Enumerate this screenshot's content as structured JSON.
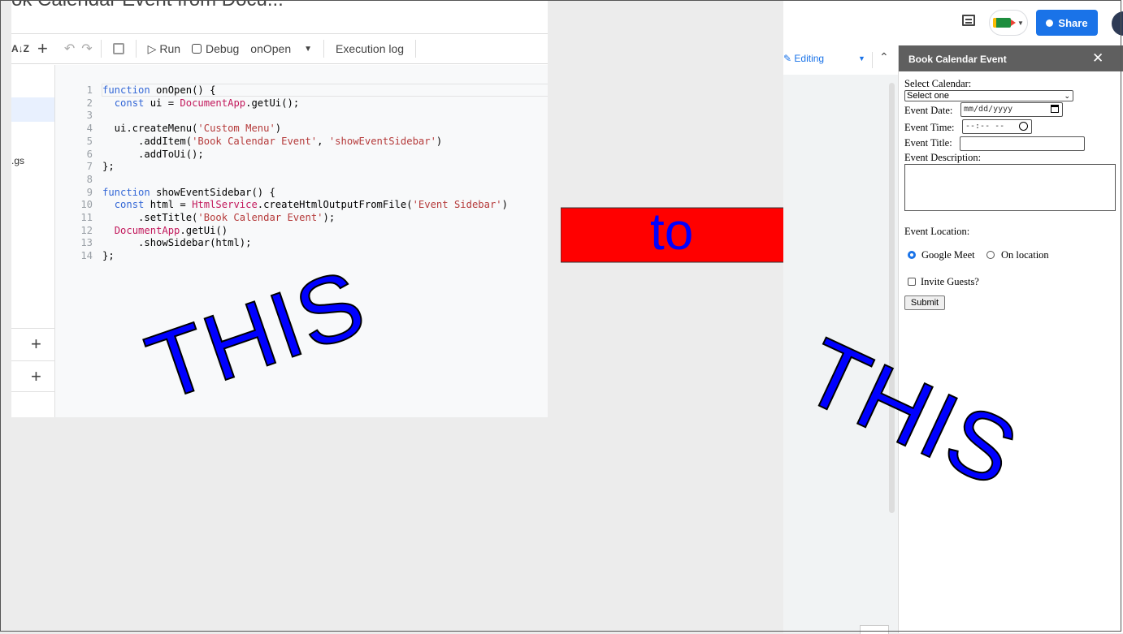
{
  "editor": {
    "title": "ok Calendar Event from Docu...",
    "toolbar": {
      "sort_icon": "A↓Z",
      "add_icon": "+",
      "undo_icon": "↶",
      "redo_icon": "↷",
      "save_icon": "💾",
      "run_label": "▷ Run",
      "debug_label": "Debug",
      "function_select": "onOpen",
      "function_caret": "▼",
      "execution_log_label": "Execution log"
    },
    "sidebar": {
      "file_label": ".gs",
      "add_library": "+",
      "add_service": "+"
    },
    "code": [
      {
        "n": "1",
        "html": "<span class='kw'>function</span> onOpen() {"
      },
      {
        "n": "2",
        "html": "  <span class='kw'>const</span> ui = <span class='cls'>DocumentApp</span>.getUi();"
      },
      {
        "n": "3",
        "html": ""
      },
      {
        "n": "4",
        "html": "  ui.createMenu(<span class='str'>'Custom Menu'</span>)"
      },
      {
        "n": "5",
        "html": "      .addItem(<span class='str'>'Book Calendar Event'</span>, <span class='str'>'showEventSidebar'</span>)"
      },
      {
        "n": "6",
        "html": "      .addToUi();"
      },
      {
        "n": "7",
        "html": "};"
      },
      {
        "n": "8",
        "html": ""
      },
      {
        "n": "9",
        "html": "<span class='kw'>function</span> showEventSidebar() {"
      },
      {
        "n": "10",
        "html": "  <span class='kw'>const</span> html = <span class='cls'>HtmlService</span>.createHtmlOutputFromFile(<span class='str'>'Event Sidebar'</span>)"
      },
      {
        "n": "11",
        "html": "      .setTitle(<span class='str'>'Book Calendar Event'</span>);"
      },
      {
        "n": "12",
        "html": "  <span class='cls'>DocumentApp</span>.getUi()"
      },
      {
        "n": "13",
        "html": "      .showSidebar(html);"
      },
      {
        "n": "14",
        "html": "};"
      }
    ]
  },
  "annotations": {
    "this_left": "THIS",
    "to": "to",
    "this_right": "THIS",
    "arrow_color": "#ff0000",
    "text_color": "#0000ff"
  },
  "docs": {
    "share_label": "Share",
    "editing_label": "Editing",
    "editing_caret": "▼",
    "collapse_icon": "⌃",
    "meet_caret": "▼",
    "sidebar": {
      "title": "Book Calendar Event",
      "close": "✕",
      "select_calendar_label": "Select Calendar:",
      "select_value": "Select one",
      "event_date_label": "Event Date:",
      "event_date_placeholder": "mm/dd/yyyy",
      "event_time_label": "Event Time:",
      "event_time_placeholder": "--:-- --",
      "event_title_label": "Event Title:",
      "event_description_label": "Event Description:",
      "event_location_label": "Event Location:",
      "google_meet_label": "Google Meet",
      "on_location_label": "On location",
      "invite_guests_label": "Invite Guests?",
      "submit_label": "Submit"
    },
    "accent": "#1a73e8"
  }
}
